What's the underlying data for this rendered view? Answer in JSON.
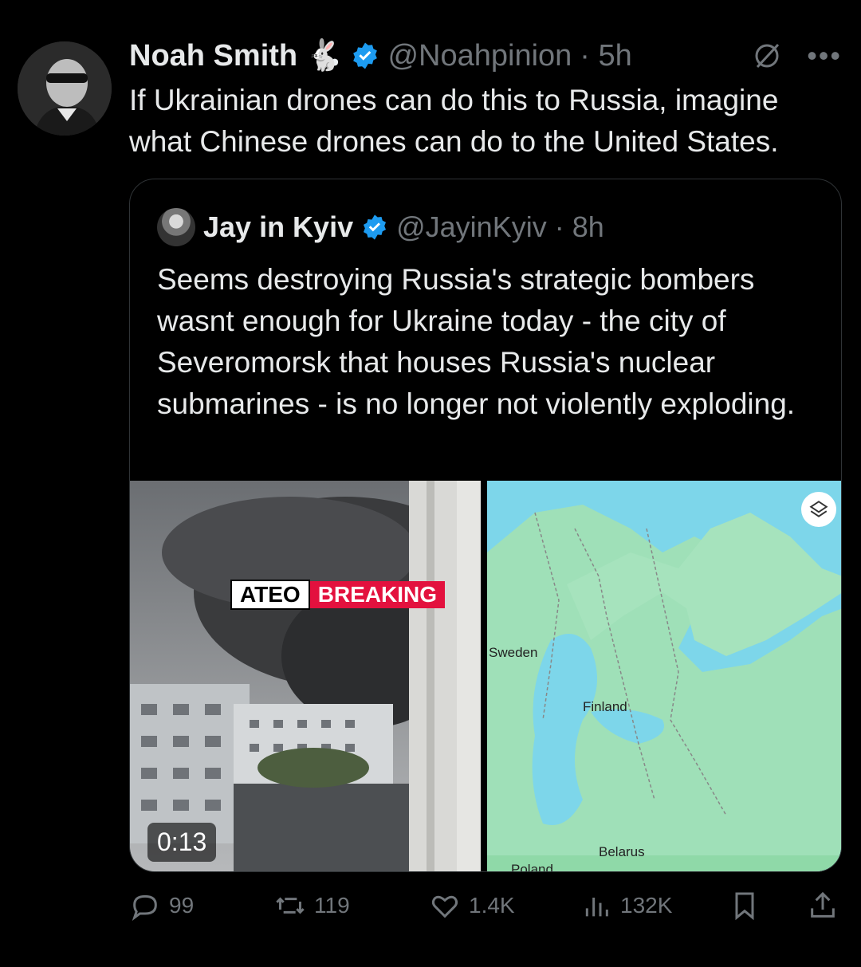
{
  "post": {
    "author_name": "Noah Smith",
    "author_emoji": "🐇",
    "author_handle": "@Noahpinion",
    "time": "· 5h",
    "text": "If Ukrainian drones can do this to Russia, imagine what Chinese drones can do to the United States.",
    "more_icon": "more-icon"
  },
  "quote": {
    "author_name": "Jay in Kyiv",
    "author_handle": "@JayinKyiv",
    "time": "· 8h",
    "text": "Seems destroying Russia's strategic bombers wasnt enough for Ukraine today - the city of Severomorsk that houses Russia's nuclear submarines - is no longer not violently exploding.",
    "video": {
      "badge_left": "ATEO",
      "badge_right": "BREAKING",
      "duration": "0:13"
    },
    "map": {
      "labels": [
        "Sweden",
        "Finland",
        "Belarus",
        "Poland"
      ]
    }
  },
  "actions": {
    "replies": "99",
    "reposts": "119",
    "likes": "1.4K",
    "views": "132K"
  },
  "colors": {
    "background": "#000000",
    "text": "#e7e9ea",
    "muted": "#71767b",
    "verified": "#1d9bf0",
    "breaking": "#e3113e"
  }
}
